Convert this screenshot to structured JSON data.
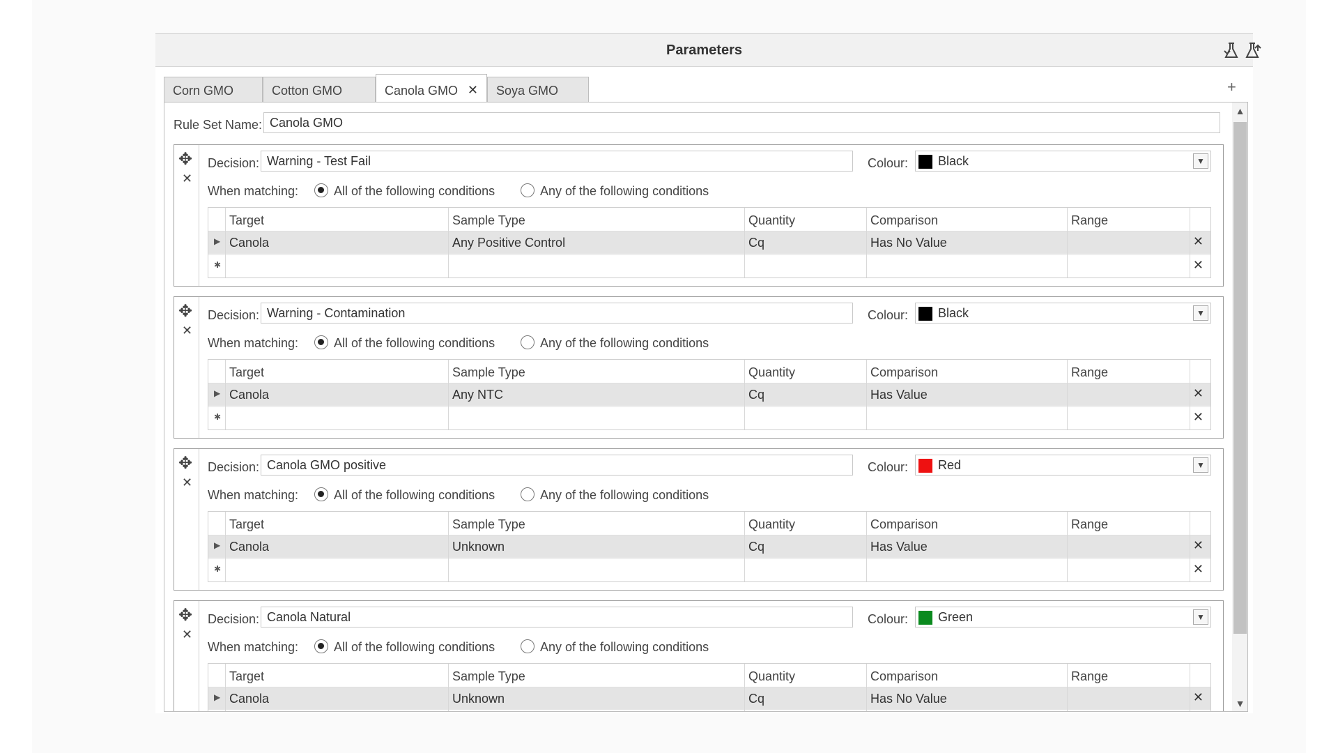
{
  "window": {
    "title": "Parameters",
    "icons": [
      "flask-import-icon",
      "flask-export-icon"
    ]
  },
  "tabs": [
    {
      "label": "Corn GMO"
    },
    {
      "label": "Cotton GMO"
    },
    {
      "label": "Canola GMO",
      "close": "✕"
    },
    {
      "label": "Soya GMO"
    }
  ],
  "add_tab": "+",
  "rule_set": {
    "label": "Rule Set Name:",
    "value": "Canola GMO"
  },
  "columns": [
    "Target",
    "Sample Type",
    "Quantity",
    "Comparison",
    "Range"
  ],
  "rules": [
    {
      "decision_label": "Decision:",
      "decision": "Warning - Test Fail",
      "colour_label": "Colour:",
      "colour_name": "Black",
      "colour_hex": "#000000",
      "match_label": "When matching:",
      "opt_all": "All of the following conditions",
      "opt_any": "Any of the following conditions",
      "selected": "all",
      "row": {
        "target": "Canola",
        "sample_type": "Any Positive Control",
        "quantity": "Cq",
        "comparison": "Has No Value",
        "range": ""
      }
    },
    {
      "decision_label": "Decision:",
      "decision": "Warning - Contamination",
      "colour_label": "Colour:",
      "colour_name": "Black",
      "colour_hex": "#000000",
      "match_label": "When matching:",
      "opt_all": "All of the following conditions",
      "opt_any": "Any of the following conditions",
      "selected": "all",
      "row": {
        "target": "Canola",
        "sample_type": "Any NTC",
        "quantity": "Cq",
        "comparison": "Has Value",
        "range": ""
      }
    },
    {
      "decision_label": "Decision:",
      "decision": "Canola GMO positive",
      "colour_label": "Colour:",
      "colour_name": "Red",
      "colour_hex": "#ee1111",
      "match_label": "When matching:",
      "opt_all": "All of the following conditions",
      "opt_any": "Any of the following conditions",
      "selected": "all",
      "row": {
        "target": "Canola",
        "sample_type": "Unknown",
        "quantity": "Cq",
        "comparison": "Has Value",
        "range": ""
      }
    },
    {
      "decision_label": "Decision:",
      "decision": "Canola Natural",
      "colour_label": "Colour:",
      "colour_name": "Green",
      "colour_hex": "#0a8a1e",
      "match_label": "When matching:",
      "opt_all": "All of the following conditions",
      "opt_any": "Any of the following conditions",
      "selected": "all",
      "row": {
        "target": "Canola",
        "sample_type": "Unknown",
        "quantity": "Cq",
        "comparison": "Has No Value",
        "range": ""
      }
    }
  ]
}
